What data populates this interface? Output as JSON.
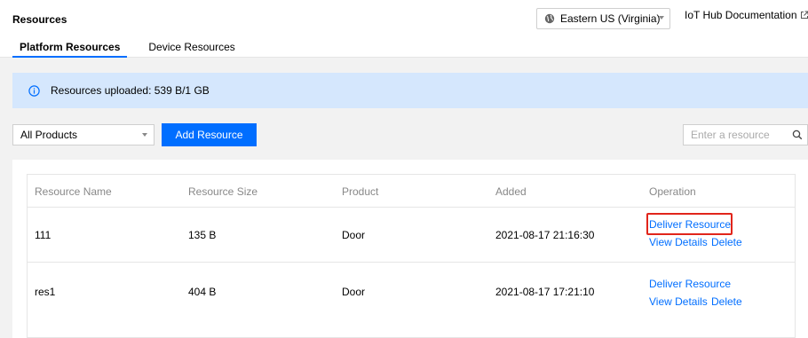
{
  "header": {
    "title": "Resources",
    "region": "Eastern US (Virginia)",
    "doc_link": "IoT Hub Documentation"
  },
  "tabs": [
    {
      "label": "Platform Resources",
      "active": true
    },
    {
      "label": "Device Resources",
      "active": false
    }
  ],
  "notice": {
    "text": "Resources uploaded: 539 B/1 GB"
  },
  "toolbar": {
    "product_select": "All Products",
    "add_button": "Add Resource",
    "search_placeholder": "Enter a resource"
  },
  "table": {
    "columns": [
      "Resource Name",
      "Resource Size",
      "Product",
      "Added",
      "Operation"
    ],
    "rows": [
      {
        "name": "111",
        "size": "135 B",
        "product": "Door",
        "added": "2021-08-17 21:16:30",
        "deliver": "Deliver Resource",
        "view": "View Details",
        "delete": "Delete"
      },
      {
        "name": "res1",
        "size": "404 B",
        "product": "Door",
        "added": "2021-08-17 17:21:10",
        "deliver": "Deliver Resource",
        "view": "View Details",
        "delete": "Delete"
      }
    ]
  },
  "colors": {
    "accent": "#006eff",
    "notice_bg": "#d5e7fd",
    "highlight": "#e1251b"
  }
}
